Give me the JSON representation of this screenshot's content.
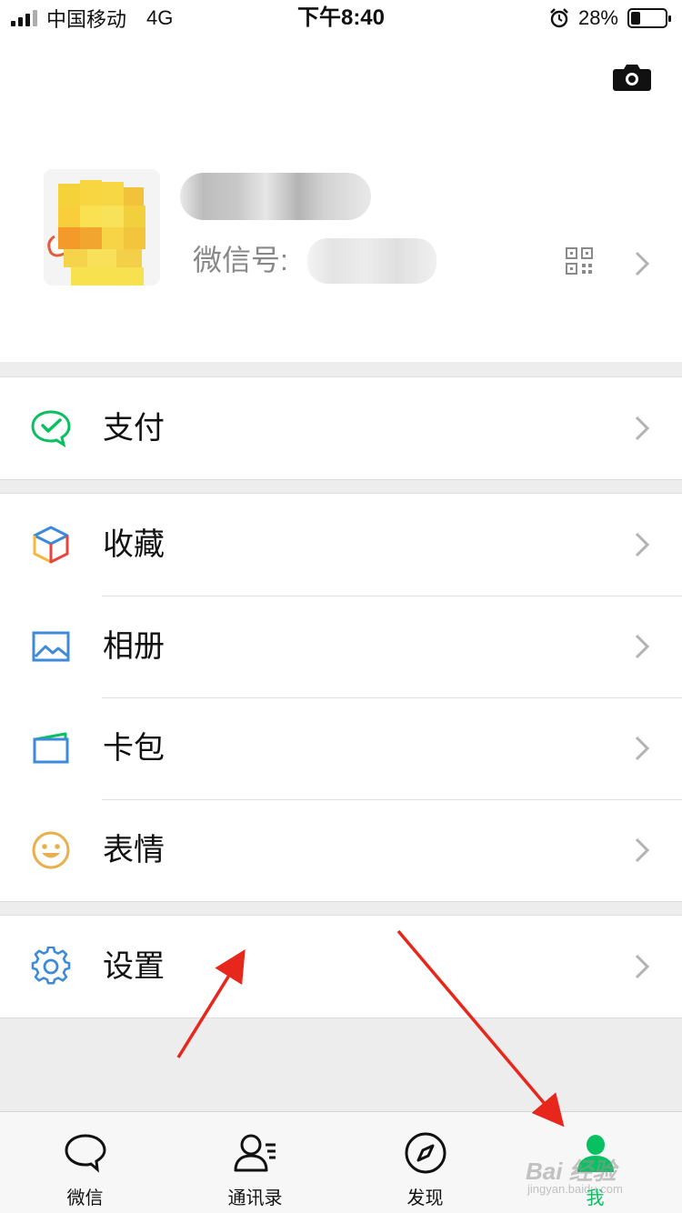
{
  "status_bar": {
    "carrier": "中国移动",
    "network": "4G",
    "time": "下午8:40",
    "battery_percent": "28%",
    "battery_level": 0.28,
    "icons": [
      "signal-icon",
      "alarm-icon",
      "battery-icon"
    ]
  },
  "profile": {
    "wechat_id_label": "微信号:",
    "icons": [
      "camera-icon",
      "qr-code-icon",
      "chevron-right-icon"
    ]
  },
  "menu": {
    "pay": {
      "label": "支付",
      "icon": "wechat-pay-icon",
      "color": "#07c160"
    },
    "favorites": {
      "label": "收藏",
      "icon": "favorites-cube-icon"
    },
    "album": {
      "label": "相册",
      "icon": "album-picture-icon",
      "color": "#3d8ad8"
    },
    "cards": {
      "label": "卡包",
      "icon": "card-wallet-icon",
      "color": "#3d8ad8"
    },
    "stickers": {
      "label": "表情",
      "icon": "smiley-icon",
      "color": "#e8b04b"
    },
    "settings": {
      "label": "设置",
      "icon": "gear-icon",
      "color": "#3d8ad8"
    }
  },
  "tabbar": {
    "tabs": [
      {
        "label": "微信",
        "icon": "chat-bubble-icon",
        "active": false
      },
      {
        "label": "通讯录",
        "icon": "contacts-icon",
        "active": false
      },
      {
        "label": "发现",
        "icon": "compass-icon",
        "active": false
      },
      {
        "label": "我",
        "icon": "me-person-icon",
        "active": true
      }
    ],
    "active_color": "#07c160"
  },
  "watermark": {
    "brand": "Bai 经验",
    "url": "jingyan.baidu.com"
  },
  "colors": {
    "background": "#ededed",
    "accent": "#07c160",
    "annotation_arrow": "#e8271c"
  }
}
